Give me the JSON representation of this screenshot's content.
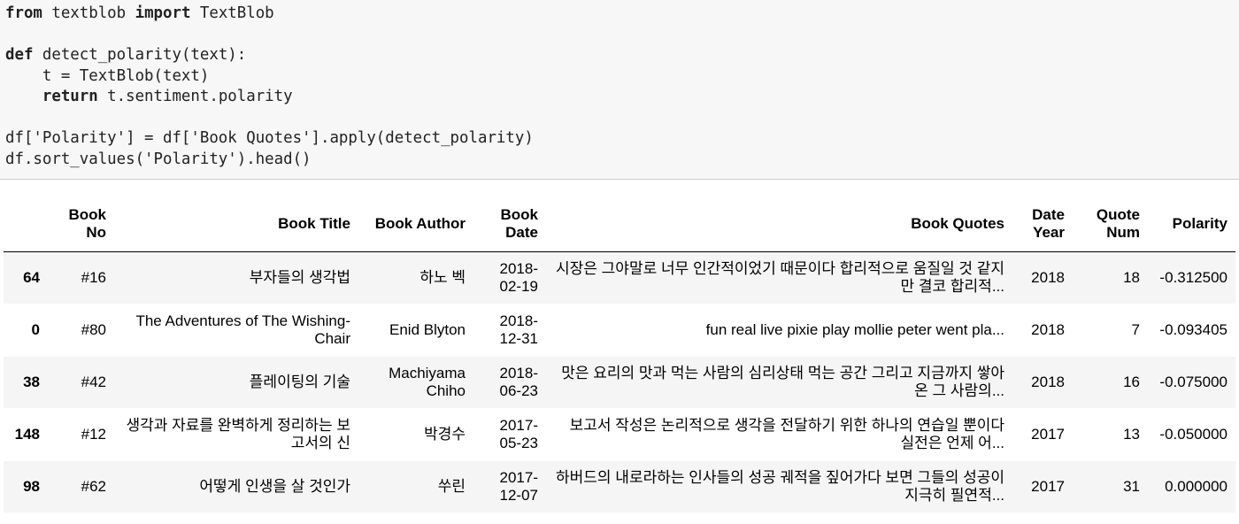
{
  "code": {
    "lines": [
      {
        "kw1": "from",
        "mid": " textblob ",
        "kw2": "import",
        "rest": " TextBlob"
      },
      {
        "kw1": "",
        "mid": "",
        "kw2": "",
        "rest": ""
      },
      {
        "kw1": "def",
        "mid": " detect_polarity(text):",
        "kw2": "",
        "rest": ""
      },
      {
        "kw1": "",
        "mid": "    t = TextBlob(text)",
        "kw2": "",
        "rest": ""
      },
      {
        "kw1": "    return",
        "mid": " t.sentiment.polarity",
        "kw2": "",
        "rest": ""
      },
      {
        "kw1": "",
        "mid": "",
        "kw2": "",
        "rest": ""
      },
      {
        "kw1": "",
        "mid": "df['Polarity'] = df['Book Quotes'].apply(detect_polarity)",
        "kw2": "",
        "rest": ""
      },
      {
        "kw1": "",
        "mid": "df.sort_values('Polarity').head()",
        "kw2": "",
        "rest": ""
      }
    ]
  },
  "table": {
    "headers": [
      "",
      "Book No",
      "Book Title",
      "Book Author",
      "Book Date",
      "Book Quotes",
      "Date Year",
      "Quote Num",
      "Polarity"
    ],
    "rows": [
      {
        "index": "64",
        "book_no": "#16",
        "title": "부자들의 생각법",
        "author": "하노 벡",
        "date": "2018-02-19",
        "quotes": "시장은 그야말로 너무 인간적이었기 때문이다 합리적으로 움질일 것 같지만 결코 합리적...",
        "year": "2018",
        "quote_num": "18",
        "polarity": "-0.312500"
      },
      {
        "index": "0",
        "book_no": "#80",
        "title": "The Adventures of The Wishing-Chair",
        "author": "Enid Blyton",
        "date": "2018-12-31",
        "quotes": "fun real live pixie play mollie peter went pla...",
        "year": "2018",
        "quote_num": "7",
        "polarity": "-0.093405"
      },
      {
        "index": "38",
        "book_no": "#42",
        "title": "플레이팅의 기술",
        "author": "Machiyama Chiho",
        "date": "2018-06-23",
        "quotes": "맛은 요리의 맛과 먹는 사람의 심리상태 먹는 공간 그리고 지금까지 쌓아온 그 사람의...",
        "year": "2018",
        "quote_num": "16",
        "polarity": "-0.075000"
      },
      {
        "index": "148",
        "book_no": "#12",
        "title": "생각과 자료를 완벽하게 정리하는 보고서의 신",
        "author": "박경수",
        "date": "2017-05-23",
        "quotes": "보고서 작성은 논리적으로 생각을 전달하기 위한 하나의 연습일 뿐이다 실전은 언제 어...",
        "year": "2017",
        "quote_num": "13",
        "polarity": "-0.050000"
      },
      {
        "index": "98",
        "book_no": "#62",
        "title": "어떻게 인생을 살 것인가",
        "author": "쑤린",
        "date": "2017-12-07",
        "quotes": "하버드의 내로라하는 인사들의 성공 궤적을 짚어가다 보면 그들의 성공이 지극히 필연적...",
        "year": "2017",
        "quote_num": "31",
        "polarity": "0.000000"
      }
    ]
  }
}
